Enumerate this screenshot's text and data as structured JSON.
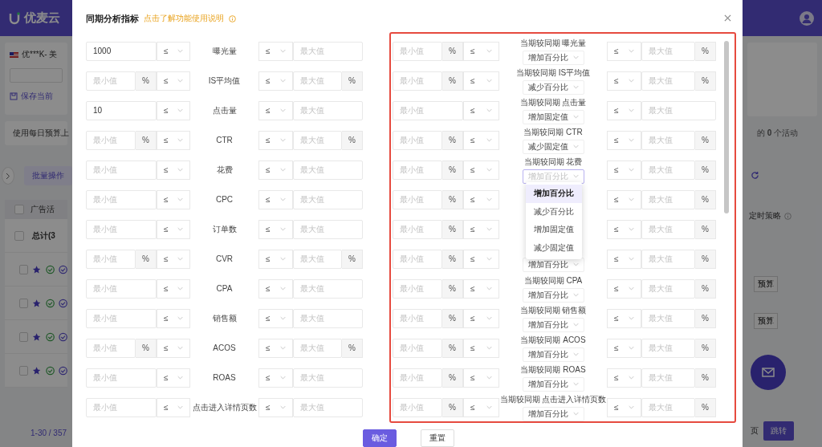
{
  "background": {
    "logo": "优麦云",
    "account": "优***K- 美",
    "save_view": "保存当前",
    "budget_note": "使用每日预算上",
    "batch_button": "批量操作",
    "table_header": "广告活",
    "total": "总计(3",
    "pagination": "1-30 / 357",
    "activity_count": "的 **0** 个活动",
    "strategy_header": "定时策略",
    "budget_buttons": [
      "预算",
      "预算"
    ],
    "page_label": "页",
    "jump_button": "跳转",
    "header_checked": false,
    "total_checked": false,
    "rows": [
      {
        "checked": false
      },
      {
        "checked": false
      },
      {
        "checked": false
      },
      {
        "checked": false
      }
    ]
  },
  "modal": {
    "title": "同期分析指标",
    "help_link": "点击了解功能使用说明",
    "left_rows": [
      {
        "min_value": "1000",
        "op_min": "≤",
        "label": "曝光量",
        "op_max": "≤",
        "max_placeholder": "最大值"
      },
      {
        "min_placeholder": "最小值",
        "unit": "%",
        "op_min": "≤",
        "label": "IS平均值",
        "op_max": "≤",
        "max_placeholder": "最大值"
      },
      {
        "min_value": "10",
        "op_min": "≤",
        "label": "点击量",
        "op_max": "≤",
        "max_placeholder": "最大值"
      },
      {
        "min_placeholder": "最小值",
        "unit": "%",
        "op_min": "≤",
        "label": "CTR",
        "op_max": "≤",
        "max_placeholder": "最大值"
      },
      {
        "min_placeholder": "最小值",
        "op_min": "≤",
        "label": "花费",
        "op_max": "≤",
        "max_placeholder": "最大值"
      },
      {
        "min_placeholder": "最小值",
        "op_min": "≤",
        "label": "CPC",
        "op_max": "≤",
        "max_placeholder": "最大值"
      },
      {
        "min_placeholder": "最小值",
        "op_min": "≤",
        "label": "订单数",
        "op_max": "≤",
        "max_placeholder": "最大值"
      },
      {
        "min_placeholder": "最小值",
        "unit": "%",
        "op_min": "≤",
        "label": "CVR",
        "op_max": "≤",
        "max_placeholder": "最大值"
      },
      {
        "min_placeholder": "最小值",
        "op_min": "≤",
        "label": "CPA",
        "op_max": "≤",
        "max_placeholder": "最大值"
      },
      {
        "min_placeholder": "最小值",
        "op_min": "≤",
        "label": "销售额",
        "op_max": "≤",
        "max_placeholder": "最大值"
      },
      {
        "min_placeholder": "最小值",
        "unit": "%",
        "op_min": "≤",
        "label": "ACOS",
        "op_max": "≤",
        "max_placeholder": "最大值"
      },
      {
        "min_placeholder": "最小值",
        "op_min": "≤",
        "label": "ROAS",
        "op_max": "≤",
        "max_placeholder": "最大值"
      },
      {
        "min_placeholder": "最小值",
        "op_min": "≤",
        "label": "点击进入详情页数",
        "op_max": "≤",
        "max_placeholder": "最大值"
      }
    ],
    "right_rows": [
      {
        "min_placeholder": "最小值",
        "unit": "%",
        "op_min": "≤",
        "label": "当期较同期 曝光量",
        "change": "增加百分比",
        "op_max": "≤",
        "max_placeholder": "最大值"
      },
      {
        "min_placeholder": "最小值",
        "unit": "%",
        "op_min": "≤",
        "label": "当期较同期 IS平均值",
        "change": "减少百分比",
        "op_max": "≤",
        "max_placeholder": "最大值"
      },
      {
        "min_placeholder": "最小值",
        "op_min": "≤",
        "label": "当期较同期 点击量",
        "change": "增加固定值",
        "op_max": "≤",
        "max_placeholder": "最大值"
      },
      {
        "min_placeholder": "最小值",
        "unit": "%",
        "op_min": "≤",
        "label": "当期较同期 CTR",
        "change": "减少固定值",
        "op_max": "≤",
        "max_placeholder": "最大值"
      },
      {
        "min_placeholder": "最小值",
        "unit": "%",
        "op_min": "≤",
        "label": "当期较同期 花费",
        "change_placeholder": "增加百分比",
        "op_max": "≤",
        "max_placeholder": "最大值",
        "dropdown": [
          {
            "label": "增加百分比",
            "selected": true
          },
          {
            "label": "减少百分比",
            "selected": false
          },
          {
            "label": "增加固定值",
            "selected": false
          },
          {
            "label": "减少固定值",
            "selected": false
          }
        ]
      },
      {
        "min_placeholder": "最小值",
        "unit": "%",
        "op_min": "≤",
        "op_max": "≤",
        "max_placeholder": "最大值"
      },
      {
        "min_placeholder": "最小值",
        "unit": "%",
        "op_min": "≤",
        "op_max": "≤",
        "max_placeholder": "最大值"
      },
      {
        "min_placeholder": "最小值",
        "unit": "%",
        "op_min": "≤",
        "change": "增加百分比",
        "op_max": "≤",
        "max_placeholder": "最大值"
      },
      {
        "min_placeholder": "最小值",
        "unit": "%",
        "op_min": "≤",
        "label": "当期较同期 CPA",
        "change": "增加百分比",
        "op_max": "≤",
        "max_placeholder": "最大值"
      },
      {
        "min_placeholder": "最小值",
        "unit": "%",
        "op_min": "≤",
        "label": "当期较同期 销售额",
        "change": "增加百分比",
        "op_max": "≤",
        "max_placeholder": "最大值"
      },
      {
        "min_placeholder": "最小值",
        "unit": "%",
        "op_min": "≤",
        "label": "当期较同期 ACOS",
        "change": "增加百分比",
        "op_max": "≤",
        "max_placeholder": "最大值"
      },
      {
        "min_placeholder": "最小值",
        "unit": "%",
        "op_min": "≤",
        "label": "当期较同期 ROAS",
        "change": "增加百分比",
        "op_max": "≤",
        "max_placeholder": "最大值"
      },
      {
        "min_placeholder": "最小值",
        "unit": "%",
        "op_min": "≤",
        "label": "当期较同期 点击进入详情页数",
        "change": "增加百分比",
        "op_max": "≤",
        "max_placeholder": "最大值"
      }
    ],
    "buttons": [
      {
        "label": "确定",
        "kind": "primary"
      },
      {
        "label": "重置",
        "kind": "default"
      }
    ]
  }
}
